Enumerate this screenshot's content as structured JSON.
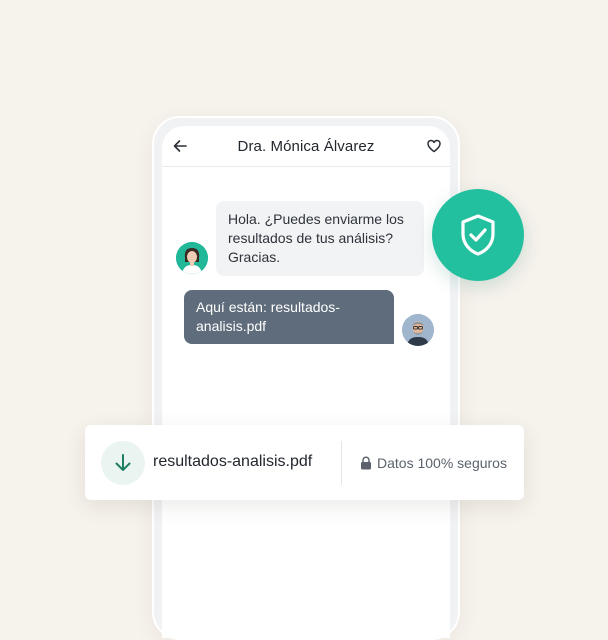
{
  "chat": {
    "title": "Dra. Mónica Álvarez",
    "back_icon": "arrow-left-icon",
    "favorite_icon": "heart-icon",
    "messages": [
      {
        "sender": "doctor",
        "text": "Hola. ¿Puedes enviarme los resultados de tus análisis? Gracias."
      },
      {
        "sender": "patient",
        "text": "Aquí están: resultados-analisis.pdf"
      }
    ]
  },
  "security_badge": {
    "icon": "shield-check-icon",
    "color": "#23c0a0"
  },
  "download_card": {
    "icon": "download-arrow-icon",
    "file_name": "resultados-analisis.pdf",
    "security_icon": "lock-icon",
    "security_text": "Datos 100% seguros"
  },
  "colors": {
    "background": "#f6f2ec",
    "accent": "#23c0a0",
    "outgoing_bubble": "#5f6c7b",
    "incoming_bubble": "#f2f3f5"
  }
}
